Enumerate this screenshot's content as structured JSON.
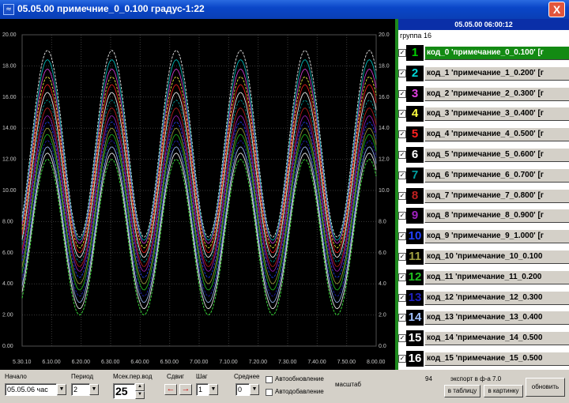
{
  "window": {
    "title": "05.05.00 примечние_0_0.100 градус-1:22",
    "close_label": "X",
    "icon": "app-chart-icon"
  },
  "chart_data": {
    "type": "line",
    "x_ticks": [
      "5.30.10",
      "6.10.00",
      "6.20.00",
      "6.30.00",
      "6.40.00",
      "6.50.00",
      "7.00.00",
      "7.10.00",
      "7.20.00",
      "7.30.00",
      "7.40.00",
      "7.50.00",
      "8.00.00"
    ],
    "y_left_ticks": [
      "0.00",
      "2.00",
      "4.00",
      "6.00",
      "8.00",
      "10.00",
      "12.00",
      "14.00",
      "16.00",
      "18.00",
      "20.00"
    ],
    "y_right_ticks": [
      "0.0",
      "2.0",
      "4.0",
      "6.0",
      "8.0",
      "10.0",
      "12.0",
      "14.0",
      "16.0",
      "18.0",
      "20.0"
    ],
    "ylim": [
      0,
      20
    ],
    "grid": true,
    "cycles": 5.5,
    "series": [
      {
        "color": "#ffffff",
        "mid": 13.0,
        "amp": 6.0
      },
      {
        "color": "#00c8c8",
        "mid": 12.6,
        "amp": 5.8
      },
      {
        "color": "#e040e0",
        "mid": 12.2,
        "amp": 5.6
      },
      {
        "color": "#ffff40",
        "mid": 11.8,
        "amp": 5.5
      },
      {
        "color": "#ff2020",
        "mid": 11.4,
        "amp": 5.4
      },
      {
        "color": "#ffffff",
        "mid": 11.0,
        "amp": 5.3
      },
      {
        "color": "#00a0a0",
        "mid": 10.6,
        "amp": 5.2
      },
      {
        "color": "#c02020",
        "mid": 10.2,
        "amp": 5.1
      },
      {
        "color": "#a020c0",
        "mid": 9.8,
        "amp": 5.0
      },
      {
        "color": "#2040ff",
        "mid": 9.4,
        "amp": 5.0
      },
      {
        "color": "#a0a040",
        "mid": 9.0,
        "amp": 5.0
      },
      {
        "color": "#20c020",
        "mid": 8.6,
        "amp": 5.0
      },
      {
        "color": "#2020c0",
        "mid": 8.2,
        "amp": 5.0
      },
      {
        "color": "#a0c0ff",
        "mid": 7.8,
        "amp": 5.0
      },
      {
        "color": "#ffffff",
        "mid": 7.4,
        "amp": 5.0
      },
      {
        "color": "#40ff40",
        "mid": 7.0,
        "amp": 5.0
      }
    ]
  },
  "panel": {
    "header": "05.05.00 06:00:12",
    "group": "группа 16",
    "items": [
      {
        "num": "1",
        "color": "#00d000",
        "label": "код_0 'примечание_0_0.100' [г",
        "checked": "✓",
        "selected": true
      },
      {
        "num": "2",
        "color": "#00d8d8",
        "label": "код_1 'примечание_1_0.200' [г",
        "checked": "✓",
        "selected": false
      },
      {
        "num": "3",
        "color": "#e040e0",
        "label": "код_2 'примечание_2_0.300' [г",
        "checked": "✓",
        "selected": false
      },
      {
        "num": "4",
        "color": "#ffff40",
        "label": "код_3 'примечание_3_0.400' [г",
        "checked": "✓",
        "selected": false
      },
      {
        "num": "5",
        "color": "#ff2020",
        "label": "код_4 'примечание_4_0.500' [г",
        "checked": "✓",
        "selected": false
      },
      {
        "num": "6",
        "color": "#ffffff",
        "label": "код_5 'примечание_5_0.600' [г",
        "checked": "✓",
        "selected": false
      },
      {
        "num": "7",
        "color": "#00a0a0",
        "label": "код_6 'примечание_6_0.700' [г",
        "checked": "✓",
        "selected": false
      },
      {
        "num": "8",
        "color": "#c02020",
        "label": "код_7 'примечание_7_0.800' [г",
        "checked": "✓",
        "selected": false
      },
      {
        "num": "9",
        "color": "#a020c0",
        "label": "код_8 'примечание_8_0.900' [г",
        "checked": "✓",
        "selected": false
      },
      {
        "num": "10",
        "color": "#2040ff",
        "label": "код_9 'примечание_9_1.000' [г",
        "checked": "✓",
        "selected": false
      },
      {
        "num": "11",
        "color": "#a0a040",
        "label": "код_10 'примечание_10_0.100",
        "checked": "✓",
        "selected": false
      },
      {
        "num": "12",
        "color": "#20c020",
        "label": "код_11 'примечание_11_0.200",
        "checked": "✓",
        "selected": false
      },
      {
        "num": "13",
        "color": "#2020c0",
        "label": "код_12 'примечание_12_0.300",
        "checked": "✓",
        "selected": false
      },
      {
        "num": "14",
        "color": "#a0c0ff",
        "label": "код_13 'примечание_13_0.400",
        "checked": "✓",
        "selected": false
      },
      {
        "num": "15",
        "color": "#ffffff",
        "label": "код_14 'примечание_14_0.500",
        "checked": "✓",
        "selected": false
      },
      {
        "num": "16",
        "color": "#ffffff",
        "label": "код_15 'примечание_15_0.500",
        "checked": "✓",
        "selected": false
      }
    ]
  },
  "controls": {
    "start_label": "Начало",
    "start_value": "05.05.06 час",
    "period_label": "Период",
    "period_value": "2",
    "mspp_label": "Мсек.пер.вод",
    "mspp_value": "25",
    "shift_label": "Сдвиг",
    "step_label": "Шаг",
    "step_value": "1",
    "avg_label": "Среднее",
    "avg_value": "0",
    "autoscale_label": "Автообновление",
    "autoupdate_label": "Автодобавление",
    "scale_label": "масштаб",
    "count_value": "94",
    "export_label": "экспорт в ф-а 7.0",
    "table_btn": "в таблицу",
    "picture_btn": "в картинку",
    "refresh_btn": "обновить"
  }
}
